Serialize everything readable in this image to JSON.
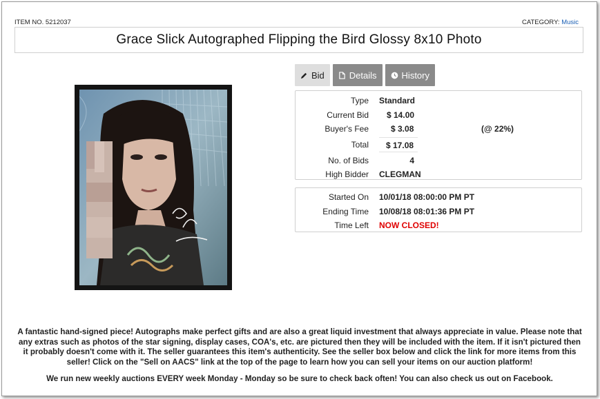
{
  "header": {
    "item_no": "ITEM NO. 5212037",
    "category_label": "CATEGORY:",
    "category_value": "Music",
    "title": "Grace Slick Autographed Flipping the Bird Glossy 8x10 Photo"
  },
  "tabs": [
    {
      "label": "Bid",
      "icon": "pencil-icon",
      "active": true
    },
    {
      "label": "Details",
      "icon": "document-icon",
      "active": false
    },
    {
      "label": "History",
      "icon": "clock-icon",
      "active": false
    }
  ],
  "bid_info": {
    "type_label": "Type",
    "type_value": "Standard",
    "current_bid_label": "Current Bid",
    "current_bid_value": "$ 14.00",
    "buyers_fee_label": "Buyer's Fee",
    "buyers_fee_value": "$ 3.08",
    "buyers_fee_pct": "(@ 22%)",
    "total_label": "Total",
    "total_value": "$ 17.08",
    "num_bids_label": "No. of Bids",
    "num_bids_value": "4",
    "high_bidder_label": "High Bidder",
    "high_bidder_value": "CLEGMAN"
  },
  "timing": {
    "started_label": "Started On",
    "started_value": "10/01/18 08:00:00 PM PT",
    "ending_label": "Ending Time",
    "ending_value": "10/08/18 08:01:36 PM PT",
    "time_left_label": "Time Left",
    "time_left_value": "NOW CLOSED!"
  },
  "description": "A fantastic hand-signed piece! Autographs make perfect gifts and are also a great liquid investment that always appreciate in value. Please note that any extras such as photos of the star signing, display cases, COA's, etc. are pictured then they will be included with the item. If it isn't pictured then it probably doesn't come with it. The seller guarantees this item's authenticity. See the seller box below and click the link for more items from this seller! Click on the \"Sell on AACS\" link at the top of the page to learn how you can sell your items on our auction platform!",
  "weekly_note": "We run new weekly auctions EVERY week Monday - Monday so be sure to check back often! You can also check us out on Facebook.",
  "colors": {
    "tab_inactive": "#8a8a8a",
    "tab_active": "#dedede",
    "closed_red": "#e00000",
    "link_blue": "#1a5fb4"
  }
}
